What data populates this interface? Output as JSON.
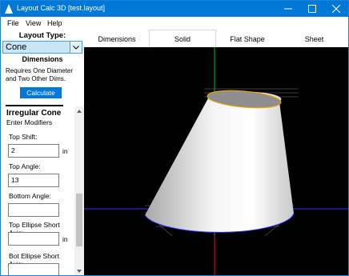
{
  "window": {
    "title": "Layout Calc 3D [test.layout]",
    "accent_color": "#0078d7",
    "title_icons": [
      "app-icon",
      "minimize-icon",
      "maximize-icon",
      "close-icon"
    ]
  },
  "menu": {
    "items": [
      "File",
      "View",
      "Help"
    ]
  },
  "sidebar": {
    "layout_type_label": "Layout Type:",
    "layout_type_value": "Cone",
    "dimensions_heading": "Dimensions",
    "dimensions_note": "Requires One Diameter and Two Other Dims.",
    "calculate_label": "Calculate",
    "irregular_title": "Irregular Cone",
    "enter_modifiers": "Enter Modifiers",
    "fields": [
      {
        "label": "Top Shift:",
        "value": "2",
        "unit": "in"
      },
      {
        "label": "Top Angle:",
        "value": "13",
        "unit": ""
      },
      {
        "label": "Bottom Angle:",
        "value": "",
        "unit": ""
      },
      {
        "label": "Top Ellipse Short Axis:",
        "value": "",
        "unit": "in"
      },
      {
        "label": "Bot Ellipse Short Axis:",
        "value": "",
        "unit": ""
      }
    ]
  },
  "tabs": [
    {
      "label": "Dimensions",
      "selected": false
    },
    {
      "label": "Solid",
      "selected": true
    },
    {
      "label": "Flat Shape",
      "selected": false
    },
    {
      "label": "Sheet",
      "selected": false
    }
  ],
  "viewport": {
    "background": "#000000",
    "axis_colors": {
      "x": "#3030ff",
      "y": "#00c000",
      "z": "#e00000"
    },
    "top_ellipse_color": "#e8a000"
  }
}
